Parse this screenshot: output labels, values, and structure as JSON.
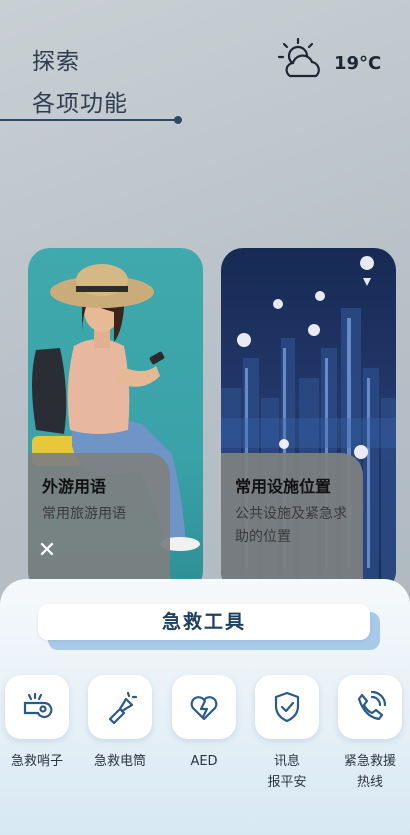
{
  "header": {
    "title_line1": "探索",
    "title_line2": "各项功能",
    "weather_icon": "partly-cloudy-icon",
    "temperature": "19°C"
  },
  "cards": [
    {
      "title": "外游用语",
      "subtitle": "常用旅游用语",
      "image": "traveler-woman-photo"
    },
    {
      "title": "常用设施位置",
      "subtitle": "公共设施及紧急求助的位置",
      "image": "city-night-map-pins-photo"
    }
  ],
  "close_icon": "close-icon",
  "first_aid": {
    "title": "急救工具",
    "tools": [
      {
        "label": "急救哨子",
        "icon": "whistle-icon"
      },
      {
        "label": "急救电筒",
        "icon": "flashlight-icon"
      },
      {
        "label": "AED",
        "icon": "heart-pulse-icon"
      },
      {
        "label": "讯息\n报平安",
        "icon": "shield-check-icon"
      },
      {
        "label": "紧急救援\n热线",
        "icon": "phone-call-icon"
      }
    ]
  },
  "colors": {
    "accent": "#1f4062",
    "teal_card": "#3fa9ad",
    "night_card": "#172a55"
  }
}
